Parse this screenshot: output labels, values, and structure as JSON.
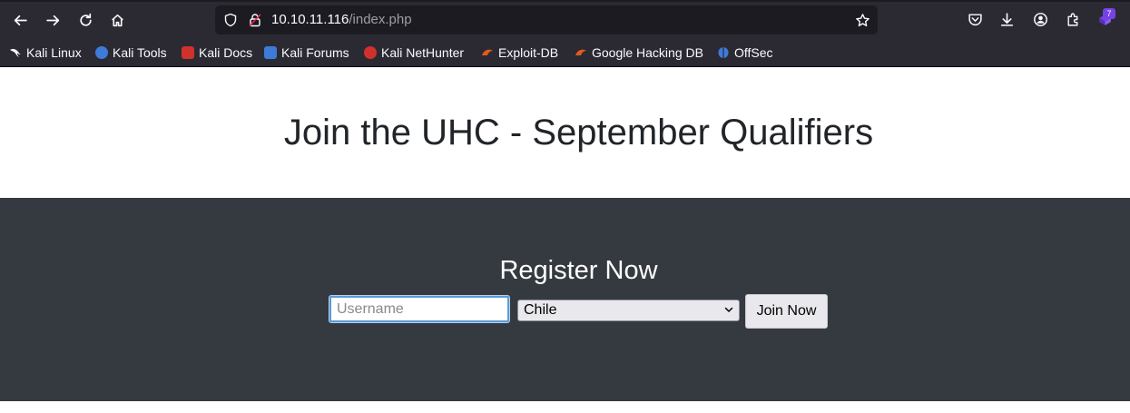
{
  "browser": {
    "url_host": "10.10.11.116",
    "url_path": "/index.php",
    "extension_badge": "7"
  },
  "bookmarks": [
    {
      "label": "Kali Linux",
      "icon": "kali-dragon-icon",
      "color": "#fbfbfe"
    },
    {
      "label": "Kali Tools",
      "icon": "kali-tools-icon",
      "color": "#3d7bd9"
    },
    {
      "label": "Kali Docs",
      "icon": "kali-docs-icon",
      "color": "#d0312d"
    },
    {
      "label": "Kali Forums",
      "icon": "kali-forums-icon",
      "color": "#3d7bd9"
    },
    {
      "label": "Kali NetHunter",
      "icon": "kali-nethunter-icon",
      "color": "#d0312d"
    },
    {
      "label": "Exploit-DB",
      "icon": "exploit-db-icon",
      "color": "#e25a1c"
    },
    {
      "label": "Google Hacking DB",
      "icon": "ghdb-icon",
      "color": "#e25a1c"
    },
    {
      "label": "OffSec",
      "icon": "offsec-icon",
      "color": "#3d7bd9"
    }
  ],
  "page": {
    "title": "Join the UHC - September Qualifiers",
    "register_title": "Register Now",
    "username_placeholder": "Username",
    "country_selected": "Chile",
    "join_label": "Join Now"
  },
  "colors": {
    "chrome_bg": "#2b2a33",
    "urlbar_bg": "#1c1b22",
    "register_bg": "#343a40",
    "focus_ring": "#5b9bd5"
  }
}
